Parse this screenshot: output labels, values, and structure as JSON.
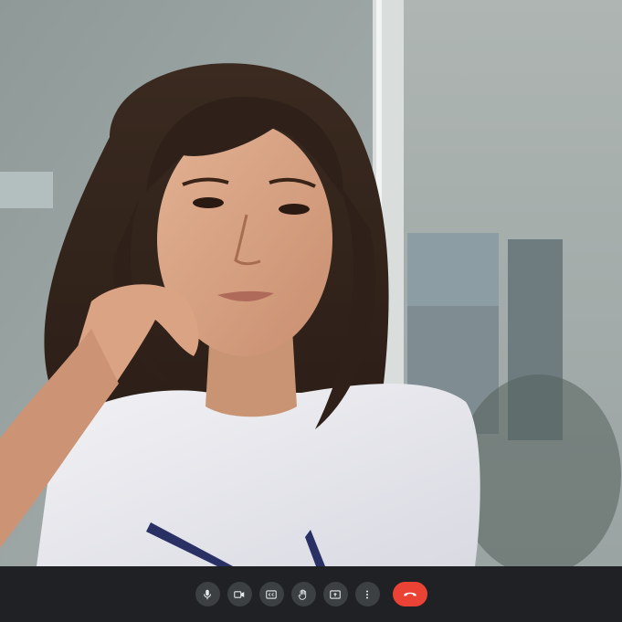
{
  "call": {
    "participant_feed": "self-view-camera",
    "controls": [
      {
        "id": "mic",
        "icon": "microphone-icon",
        "state": "on"
      },
      {
        "id": "camera",
        "icon": "video-camera-icon",
        "state": "on"
      },
      {
        "id": "captions",
        "icon": "closed-captions-icon",
        "state": "off"
      },
      {
        "id": "raise-hand",
        "icon": "raise-hand-icon",
        "state": "off"
      },
      {
        "id": "present",
        "icon": "present-screen-icon",
        "state": "off"
      },
      {
        "id": "more",
        "icon": "more-options-icon",
        "state": "closed"
      },
      {
        "id": "end-call",
        "icon": "hang-up-icon",
        "state": "active"
      }
    ],
    "colors": {
      "bar_background": "#202124",
      "button_background": "#3c4043",
      "icon_color": "#e8eaed",
      "end_call_color": "#ea4335"
    }
  }
}
